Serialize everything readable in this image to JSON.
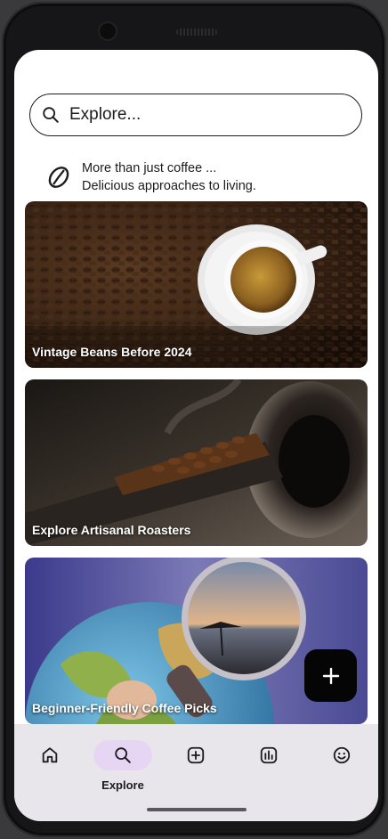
{
  "search": {
    "placeholder": "Explore..."
  },
  "tagline": {
    "line1": "More than just coffee ...",
    "line2": "Delicious approaches to living."
  },
  "cards": [
    {
      "title": "Vintage Beans Before 2024"
    },
    {
      "title": "Explore Artisanal Roasters"
    },
    {
      "title": "Beginner-Friendly Coffee Picks"
    }
  ],
  "fab": {
    "icon": "plus-icon"
  },
  "nav": {
    "items": [
      {
        "icon": "home-icon",
        "label": ""
      },
      {
        "icon": "search-icon",
        "label": "Explore",
        "active": true
      },
      {
        "icon": "add-box-icon",
        "label": ""
      },
      {
        "icon": "bar-chart-icon",
        "label": ""
      },
      {
        "icon": "smiley-icon",
        "label": ""
      }
    ]
  },
  "colors": {
    "accent_pill": "#e7d6f3",
    "navbar_bg": "#e8e6ea",
    "fab_bg": "#050505"
  }
}
